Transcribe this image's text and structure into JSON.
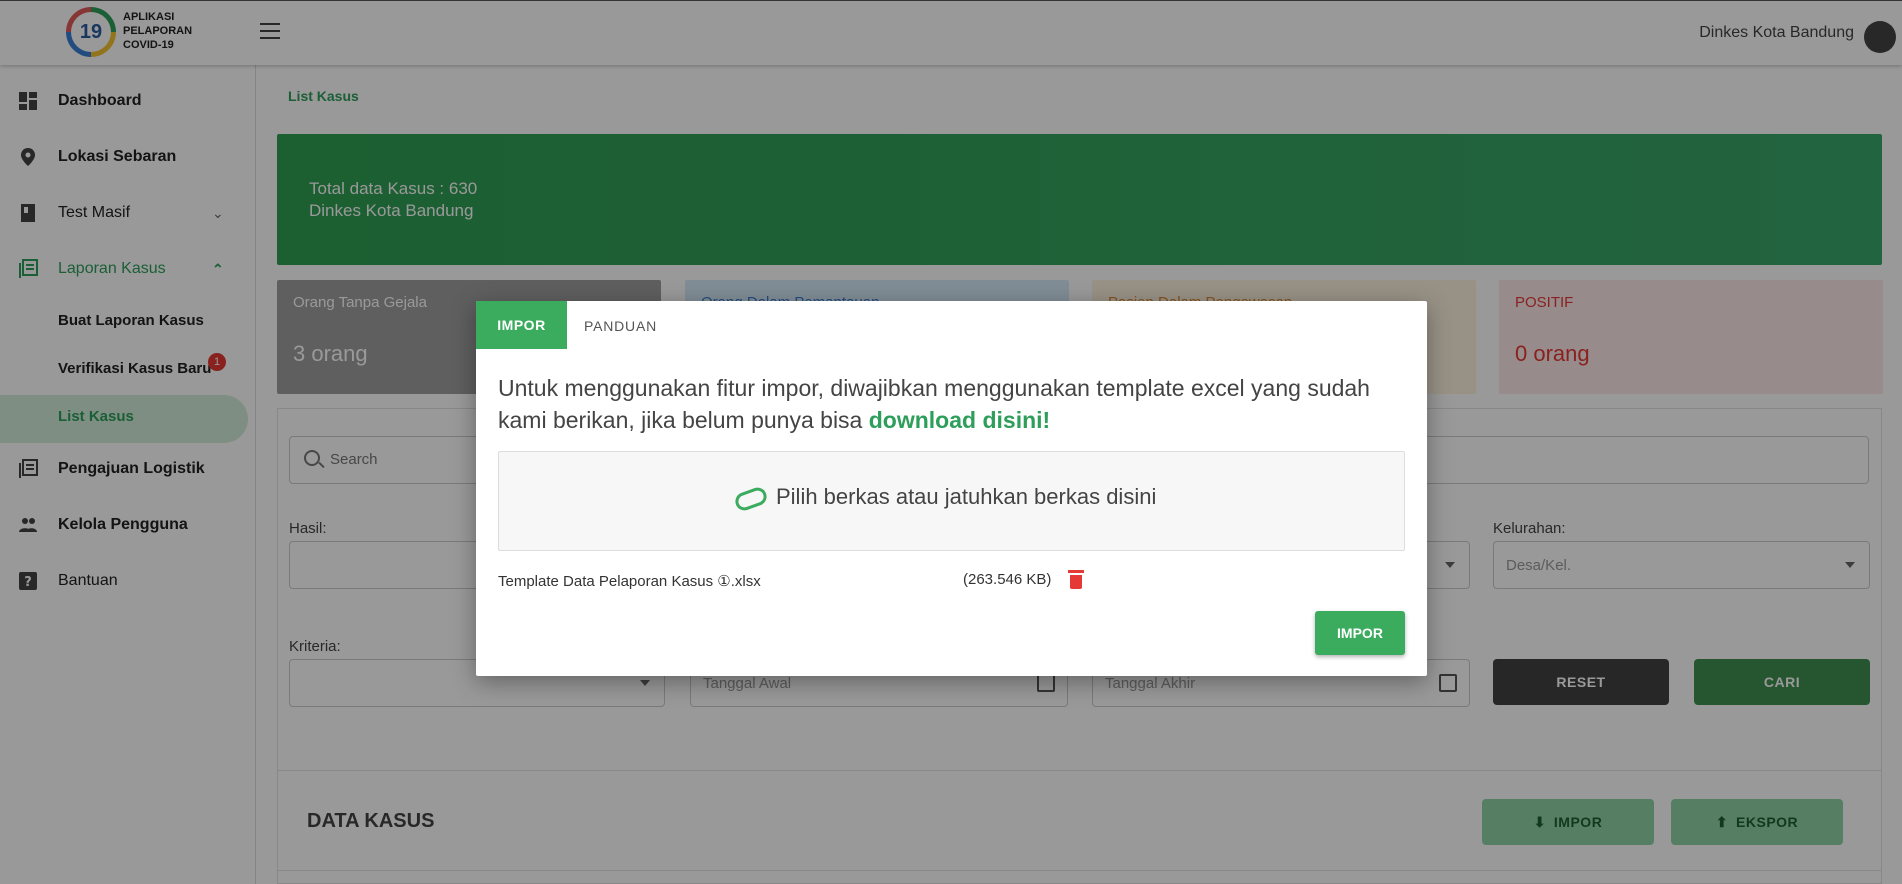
{
  "app": {
    "logo_number": "19",
    "logo_lines": [
      "APLIKASI",
      "PELAPORAN",
      "COVID-19"
    ],
    "user_name": "Dinkes Kota Bandung"
  },
  "sidebar": {
    "items": [
      {
        "label": "Dashboard",
        "icon": "dashboard-icon"
      },
      {
        "label": "Lokasi Sebaran",
        "icon": "location-pin-icon"
      },
      {
        "label": "Test Masif",
        "icon": "book-icon"
      },
      {
        "label": "Laporan Kasus",
        "icon": "library-books-icon"
      },
      {
        "label": "Pengajuan Logistik",
        "icon": "list-icon"
      },
      {
        "label": "Kelola Pengguna",
        "icon": "people-icon"
      },
      {
        "label": "Bantuan",
        "icon": "help-icon"
      }
    ],
    "subitems": [
      "Buat Laporan Kasus",
      "Verifikasi Kasus Baru",
      "List Kasus"
    ],
    "badge": "1",
    "active_color": "#2e9e5b"
  },
  "main": {
    "breadcrumb": "List Kasus",
    "banner": {
      "line1": "Total data Kasus : 630",
      "line2": "Dinkes Kota Bandung",
      "color": "#36a25f"
    },
    "stats": [
      {
        "title": "Orang Tanpa Gejala",
        "value": "3 orang",
        "bg": "#9e9e9e"
      },
      {
        "title": "Orang Dalam Pemantauan",
        "value": "",
        "bg": "#d8ecfa"
      },
      {
        "title": "Pasien Dalam Pengawasan",
        "value": "",
        "bg": "#fdf3e0"
      },
      {
        "title": "POSITIF",
        "value": "0 orang",
        "bg": "#fce8e8"
      }
    ],
    "search_placeholder": "Search",
    "filters": {
      "hasil_label": "Hasil:",
      "kelurahan_label": "Kelurahan:",
      "kelurahan_placeholder": "Desa/Kel.",
      "kriteria_label": "Kriteria:",
      "tanggal_awal": "Tanggal Awal",
      "tanggal_akhir": "Tanggal Akhir"
    },
    "buttons": {
      "reset": "RESET",
      "cari": "CARI",
      "impor": "IMPOR",
      "ekspor": "EKSPOR"
    },
    "data_title": "DATA KASUS"
  },
  "modal": {
    "tabs": [
      "IMPOR",
      "PANDUAN"
    ],
    "message": "Untuk menggunakan fitur impor, diwajibkan menggunakan template excel yang sudah kami berikan, jika belum punya bisa ",
    "download_link": "download disini!",
    "dropzone_text": "Pilih berkas atau jatuhkan berkas disini",
    "file_name": "Template Data Pelaporan Kasus ①.xlsx",
    "file_size": "(263.546 KB)",
    "impor_button": "IMPOR"
  }
}
